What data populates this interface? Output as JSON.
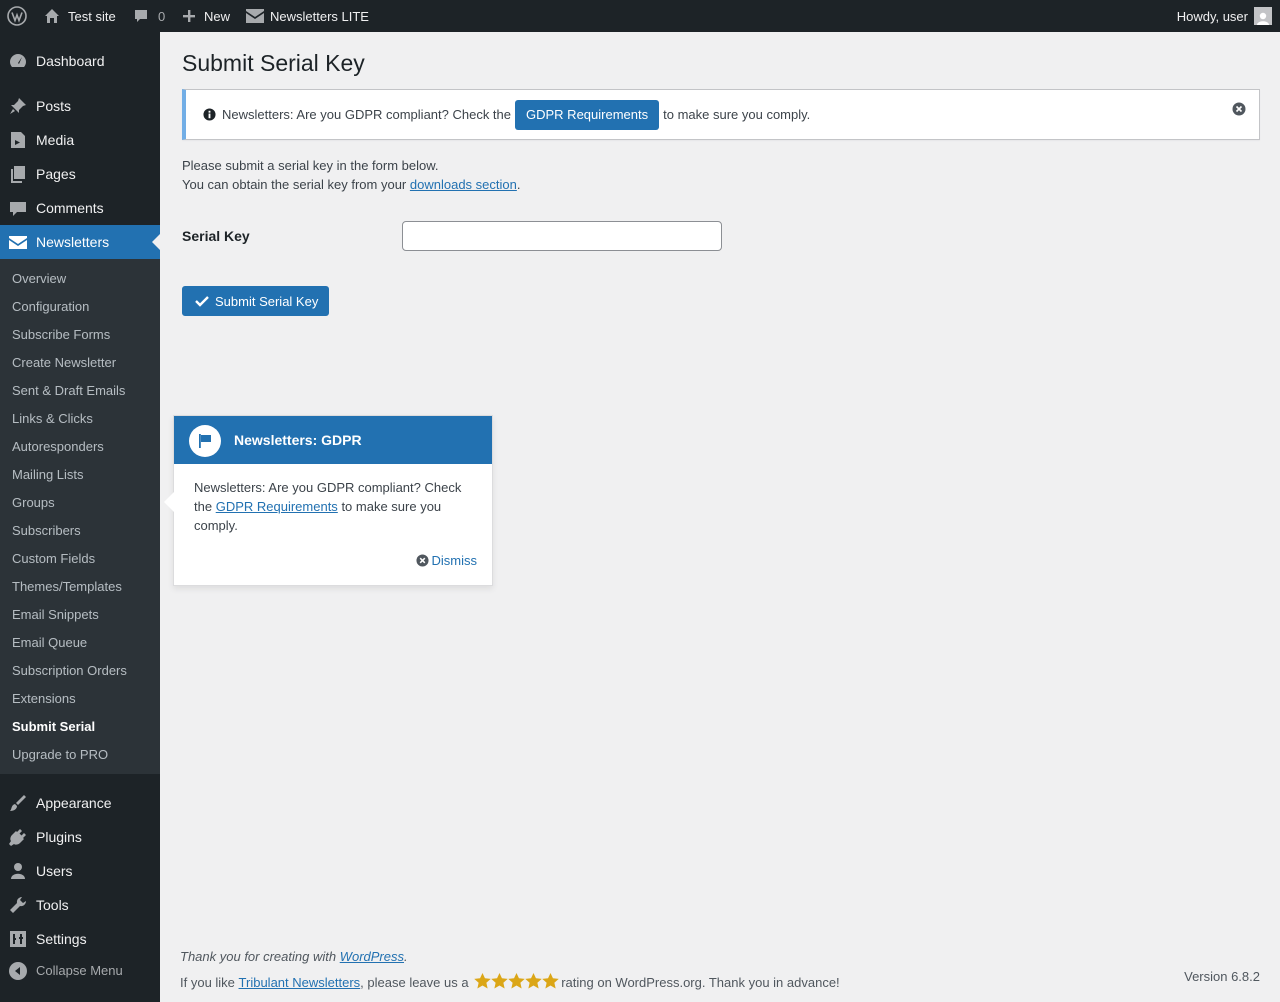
{
  "admin_bar": {
    "site_name": "Test site",
    "comments_count": "0",
    "new_label": "New",
    "plugin_label": "Newsletters LITE",
    "greeting": "Howdy, user"
  },
  "sidebar": {
    "items": [
      {
        "label": "Dashboard",
        "icon": "dashboard-icon"
      },
      {
        "label": "Posts",
        "icon": "pin-icon"
      },
      {
        "label": "Media",
        "icon": "media-icon"
      },
      {
        "label": "Pages",
        "icon": "pages-icon"
      },
      {
        "label": "Comments",
        "icon": "comment-icon"
      },
      {
        "label": "Newsletters",
        "icon": "envelope-icon"
      },
      {
        "label": "Appearance",
        "icon": "brush-icon"
      },
      {
        "label": "Plugins",
        "icon": "plug-icon"
      },
      {
        "label": "Users",
        "icon": "user-icon"
      },
      {
        "label": "Tools",
        "icon": "wrench-icon"
      },
      {
        "label": "Settings",
        "icon": "sliders-icon"
      }
    ],
    "submenu": [
      "Overview",
      "Configuration",
      "Subscribe Forms",
      "Create Newsletter",
      "Sent & Draft Emails",
      "Links & Clicks",
      "Autoresponders",
      "Mailing Lists",
      "Groups",
      "Subscribers",
      "Custom Fields",
      "Themes/Templates",
      "Email Snippets",
      "Email Queue",
      "Subscription Orders",
      "Extensions",
      "Submit Serial",
      "Upgrade to PRO"
    ],
    "collapse_label": "Collapse Menu"
  },
  "page": {
    "title": "Submit Serial Key",
    "notice": {
      "text_before": "Newsletters: Are you GDPR compliant? Check the",
      "button": "GDPR Requirements",
      "text_after": "to make sure you comply."
    },
    "intro_line1": "Please submit a serial key in the form below.",
    "intro_line2_before": "You can obtain the serial key from your",
    "intro_link": "downloads section",
    "intro_line2_after": ".",
    "field_label": "Serial Key",
    "field_value": "",
    "submit_label": "Submit Serial Key"
  },
  "pointer": {
    "title": "Newsletters: GDPR",
    "body_before": "Newsletters: Are you GDPR compliant? Check the",
    "body_link": "GDPR Requirements",
    "body_after": "to make sure you comply.",
    "dismiss": "Dismiss"
  },
  "footer": {
    "thanks_before": "Thank you for creating with",
    "thanks_link": "WordPress",
    "thanks_after": ".",
    "rate_before": "If you like",
    "rate_link": "Tribulant Newsletters",
    "rate_mid": ", please leave us a",
    "rate_after": "rating on WordPress.org. Thank you in advance!",
    "stars": 5,
    "version": "Version 6.8.2"
  },
  "colors": {
    "accent": "#2271b1",
    "adminbar_bg": "#1d2327",
    "submenu_bg": "#2c3338",
    "star": "#dba617"
  }
}
